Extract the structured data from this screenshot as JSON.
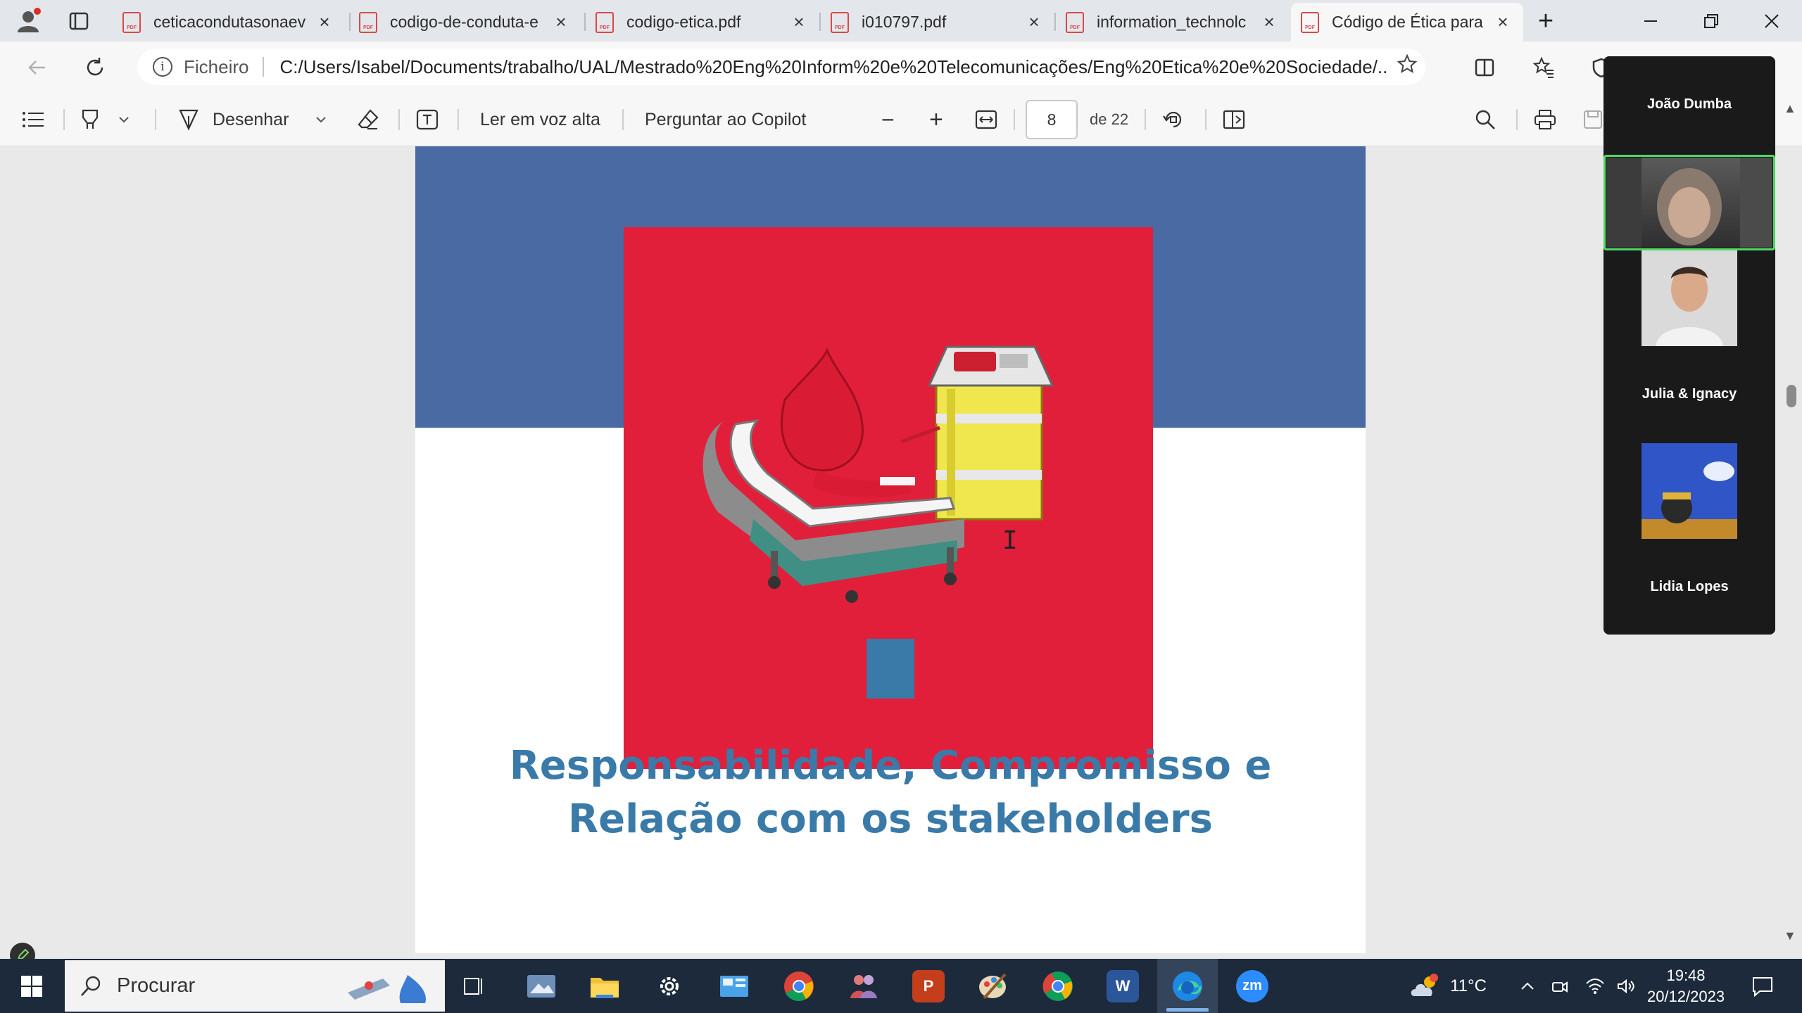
{
  "browser": {
    "tabs": [
      {
        "title": "ceticacondutasonaev",
        "active": false
      },
      {
        "title": "codigo-de-conduta-e",
        "active": false
      },
      {
        "title": "codigo-etica.pdf",
        "active": false
      },
      {
        "title": "i010797.pdf",
        "active": false
      },
      {
        "title": "information_technolc",
        "active": false
      },
      {
        "title": "Código de Ética para",
        "active": true
      }
    ],
    "tab_icon_label": "PDF",
    "close_glyph": "×",
    "new_tab_glyph": "+",
    "address": {
      "scheme_label": "Ficheiro",
      "url": "C:/Users/Isabel/Documents/trabalho/UAL/Mestrado%20Eng%20Inform%20e%20Telecomunicações/Eng%20Etica%20e%20Sociedade/..."
    }
  },
  "pdf_toolbar": {
    "draw_label": "Desenhar",
    "read_aloud_label": "Ler em voz alta",
    "copilot_label": "Perguntar ao Copilot",
    "zoom_out_glyph": "−",
    "zoom_in_glyph": "+",
    "current_page": "8",
    "page_total_label": "de 22"
  },
  "document": {
    "heading_line1": "Responsabilidade, Compromisso e",
    "heading_line2": "Relação com os stakeholders",
    "colors": {
      "band": "#4a6aa4",
      "red": "#e21f3a",
      "accent": "#3a7aa8"
    }
  },
  "zoom_gallery": {
    "participants": [
      {
        "name": "João Dumba",
        "video": false
      },
      {
        "name": "",
        "video": true,
        "active_speaker": true
      },
      {
        "name": "",
        "video": true
      },
      {
        "name": "Julia & Ignacy",
        "video": false
      },
      {
        "name": "",
        "video": true
      },
      {
        "name": "Lidia Lopes",
        "video": false
      }
    ]
  },
  "taskbar": {
    "search_placeholder": "Procurar",
    "temperature": "11°C",
    "time": "19:48",
    "date": "20/12/2023",
    "apps": [
      "task-view",
      "photos",
      "file-explorer",
      "settings",
      "control-panel",
      "chrome",
      "app-people",
      "powerpoint",
      "paint",
      "chrome-2",
      "word",
      "edge",
      "zoom"
    ],
    "word_letter": "W",
    "powerpoint_letter": "P",
    "zoom_letters": "zm"
  }
}
